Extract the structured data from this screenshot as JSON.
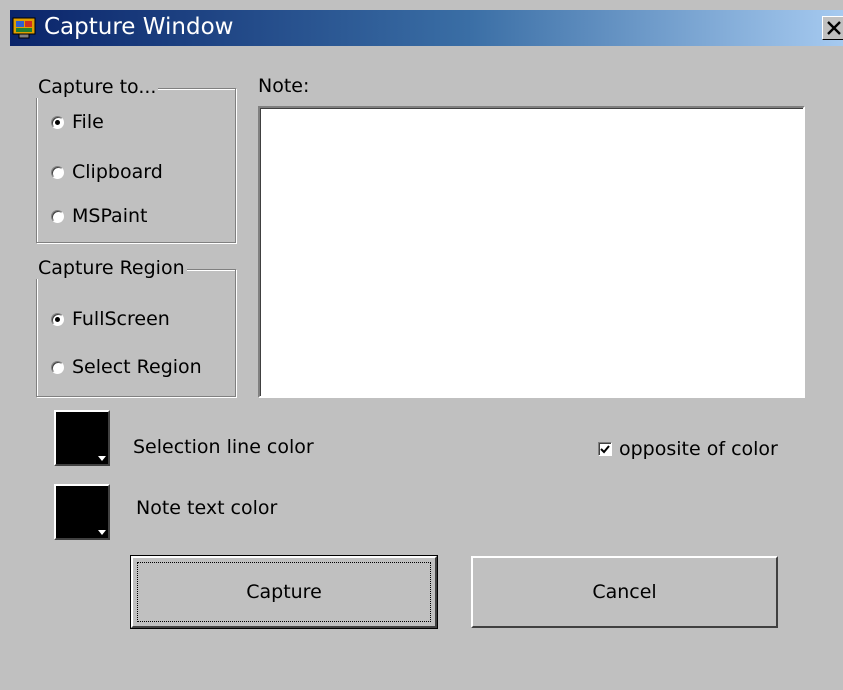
{
  "window": {
    "title": "Capture Window",
    "icon": "app-icon",
    "close_icon": "close-icon"
  },
  "capture_to": {
    "legend": "Capture to...",
    "options": [
      {
        "label": "File",
        "checked": true
      },
      {
        "label": "Clipboard",
        "checked": false
      },
      {
        "label": "MSPaint",
        "checked": false
      }
    ]
  },
  "capture_region": {
    "legend": "Capture Region",
    "options": [
      {
        "label": "FullScreen",
        "checked": true
      },
      {
        "label": "Select Region",
        "checked": false
      }
    ]
  },
  "note": {
    "label": "Note:",
    "value": ""
  },
  "colors": {
    "selection_line_label": "Selection line color",
    "selection_line_color": "#000000",
    "note_text_label": "Note text color",
    "note_text_color": "#000000"
  },
  "opposite_of_color": {
    "label": "opposite of color",
    "checked": true
  },
  "buttons": {
    "capture": "Capture",
    "cancel": "Cancel"
  }
}
